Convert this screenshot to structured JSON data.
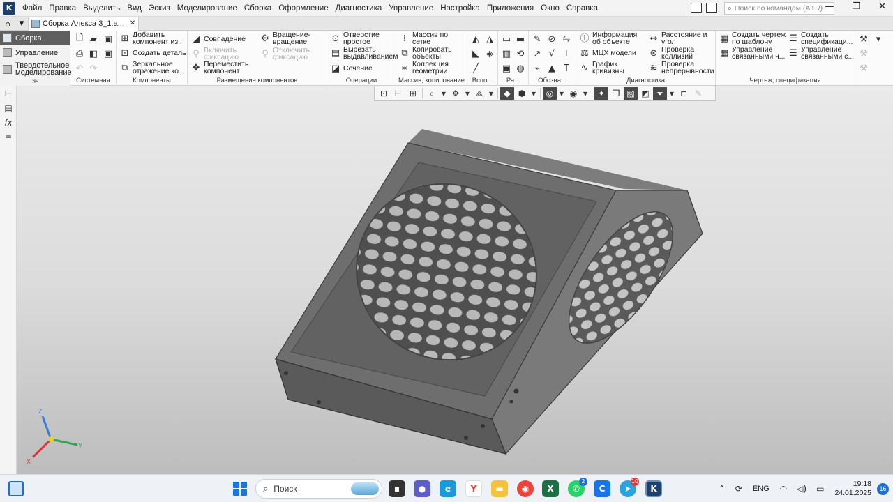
{
  "menubar": {
    "items": [
      "Файл",
      "Правка",
      "Выделить",
      "Вид",
      "Эскиз",
      "Моделирование",
      "Сборка",
      "Оформление",
      "Диагностика",
      "Управление",
      "Настройка",
      "Приложения",
      "Окно",
      "Справка"
    ],
    "search_placeholder": "Поиск по командам (Alt+/)"
  },
  "tabs": {
    "document_tab": "Сборка Алекса 3_1.a..."
  },
  "modes": {
    "items": [
      "Сборка",
      "Управление",
      "Твердотельное моделирование"
    ],
    "active": "Сборка"
  },
  "ribbon": {
    "groups": {
      "system": "Системная",
      "components": "Компоненты",
      "placement": "Размещение компонентов",
      "operations": "Операции",
      "array": "Массив, копирование",
      "aux": "Вспо...",
      "ra": "Ра...",
      "designations": "Обозна...",
      "diagnostics": "Диагностика",
      "drawing": "Чертеж, спецификация"
    },
    "buttons": {
      "add_component_1": "Добавить",
      "add_component_2": "компонент из...",
      "create_part": "Создать деталь",
      "mirror_1": "Зеркальное",
      "mirror_2": "отражение ко...",
      "coincidence": "Совпадение",
      "rotation_1": "Вращение-",
      "rotation_2": "вращение",
      "fix_1": "Включить",
      "fix_2": "фиксацию",
      "unfix_1": "Отключить",
      "unfix_2": "фиксацию",
      "move_1": "Переместить",
      "move_2": "компонент",
      "hole_1": "Отверстие",
      "hole_2": "простое",
      "cut_1": "Вырезать",
      "cut_2": "выдавливанием",
      "section": "Сечение",
      "grid_array_1": "Массив по",
      "grid_array_2": "сетке",
      "copy_1": "Копировать",
      "copy_2": "объекты",
      "collection_1": "Коллекция",
      "collection_2": "геометрии",
      "info_1": "Информация",
      "info_2": "об объекте",
      "mcx": "МЦХ модели",
      "curvature_1": "График",
      "curvature_2": "кривизны",
      "distance_1": "Расстояние и",
      "distance_2": "угол",
      "collisions_1": "Проверка",
      "collisions_2": "коллизий",
      "continuity_1": "Проверка",
      "continuity_2": "непрерывности",
      "drawing_tpl_1": "Создать чертеж",
      "drawing_tpl_2": "по шаблону",
      "spec_1": "Создать",
      "spec_2": "спецификаци...",
      "linked_1": "Управление",
      "linked_2": "связанными ч...",
      "linked_spec_1": "Управление",
      "linked_spec_2": "связанными с..."
    }
  },
  "triad": {
    "z": "Z",
    "x": "X",
    "y": "Y"
  },
  "taskbar": {
    "search_label": "Поиск",
    "lang": "ENG",
    "time": "19:18",
    "date": "24.01.2025",
    "notifications": "16",
    "whatsapp_badge": "2",
    "telegram_badge": "10"
  },
  "colors": {
    "viewport_top": "#eaeaea",
    "viewport_bottom": "#bdbdbd",
    "model_face_top": "#6e6e6e",
    "model_face_dark": "#555555",
    "active_mode": "#5f5f5f",
    "taskbar": "#eef1f6"
  }
}
